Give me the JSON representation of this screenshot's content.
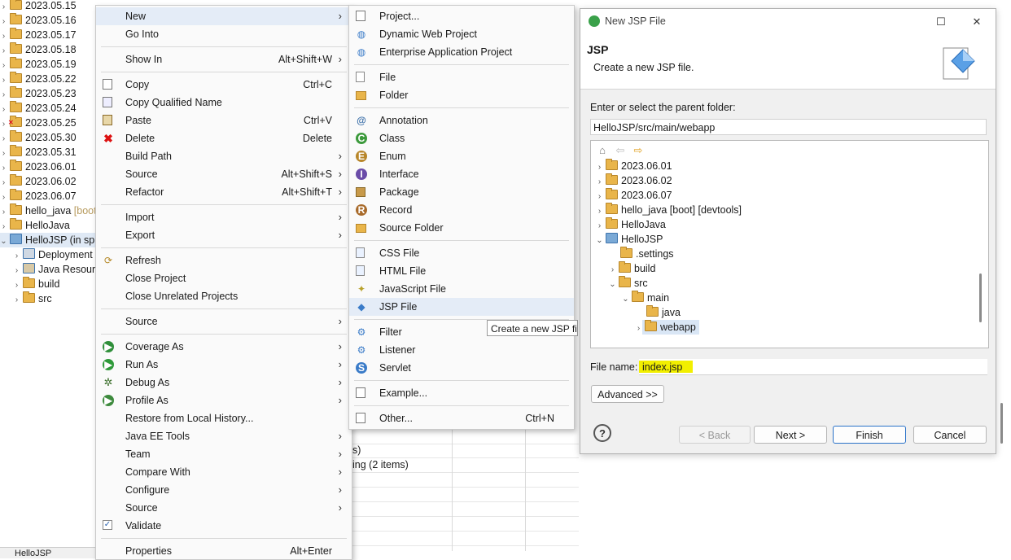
{
  "explorer": {
    "items": [
      {
        "label": "2023.05.15",
        "expanded": false,
        "error": false
      },
      {
        "label": "2023.05.16",
        "expanded": false,
        "error": false
      },
      {
        "label": "2023.05.17",
        "expanded": false,
        "error": false
      },
      {
        "label": "2023.05.18",
        "expanded": false,
        "error": false
      },
      {
        "label": "2023.05.19",
        "expanded": false,
        "error": false
      },
      {
        "label": "2023.05.22",
        "expanded": false,
        "error": false
      },
      {
        "label": "2023.05.23",
        "expanded": false,
        "error": false
      },
      {
        "label": "2023.05.24",
        "expanded": false,
        "error": false
      },
      {
        "label": "2023.05.25",
        "expanded": false,
        "error": true
      },
      {
        "label": "2023.05.30",
        "expanded": false,
        "error": false
      },
      {
        "label": "2023.05.31",
        "expanded": false,
        "error": false
      },
      {
        "label": "2023.06.01",
        "expanded": false,
        "error": false
      },
      {
        "label": "2023.06.02",
        "expanded": false,
        "error": false
      },
      {
        "label": "2023.06.07",
        "expanded": false,
        "error": false
      },
      {
        "label": "hello_java",
        "suffix": "[boot",
        "expanded": false,
        "error": false
      },
      {
        "label": "HelloJava",
        "expanded": false,
        "error": false
      },
      {
        "label": "HelloJSP (in spr",
        "expanded": true,
        "error": false,
        "selected": true
      }
    ],
    "children": [
      {
        "label": "Deployment"
      },
      {
        "label": "Java Resourc"
      },
      {
        "label": "build"
      },
      {
        "label": "src"
      }
    ],
    "bottom_tab": "HelloJSP"
  },
  "background": {
    "line1": "s)",
    "line2": "ing (2 items)"
  },
  "context_menu": {
    "items": [
      {
        "label": "New",
        "shortcut": "",
        "submenu": true
      },
      {
        "label": "Go Into",
        "shortcut": "",
        "submenu": false
      },
      {
        "label": "Show In",
        "shortcut": "Alt+Shift+W",
        "submenu": true
      },
      {
        "label": "Copy",
        "shortcut": "Ctrl+C",
        "submenu": false,
        "icon": "copy-icon"
      },
      {
        "label": "Copy Qualified Name",
        "shortcut": "",
        "submenu": false,
        "icon": "copy-qualified-icon"
      },
      {
        "label": "Paste",
        "shortcut": "Ctrl+V",
        "submenu": false,
        "icon": "paste-icon"
      },
      {
        "label": "Delete",
        "shortcut": "Delete",
        "submenu": false,
        "icon": "delete-icon"
      },
      {
        "label": "Build Path",
        "shortcut": "",
        "submenu": true
      },
      {
        "label": "Source",
        "shortcut": "Alt+Shift+S",
        "submenu": true
      },
      {
        "label": "Refactor",
        "shortcut": "Alt+Shift+T",
        "submenu": true
      },
      {
        "label": "Import",
        "shortcut": "",
        "submenu": true
      },
      {
        "label": "Export",
        "shortcut": "",
        "submenu": true
      },
      {
        "label": "Refresh",
        "shortcut": "",
        "submenu": false,
        "icon": "refresh-icon"
      },
      {
        "label": "Close Project",
        "shortcut": "",
        "submenu": false
      },
      {
        "label": "Close Unrelated Projects",
        "shortcut": "",
        "submenu": false
      },
      {
        "label": "Source",
        "shortcut": "",
        "submenu": true
      },
      {
        "label": "Coverage As",
        "shortcut": "",
        "submenu": true,
        "icon": "coverage-icon"
      },
      {
        "label": "Run As",
        "shortcut": "",
        "submenu": true,
        "icon": "run-icon"
      },
      {
        "label": "Debug As",
        "shortcut": "",
        "submenu": true,
        "icon": "debug-icon"
      },
      {
        "label": "Profile As",
        "shortcut": "",
        "submenu": true,
        "icon": "profile-icon"
      },
      {
        "label": "Restore from Local History...",
        "shortcut": "",
        "submenu": false
      },
      {
        "label": "Java EE Tools",
        "shortcut": "",
        "submenu": true
      },
      {
        "label": "Team",
        "shortcut": "",
        "submenu": true
      },
      {
        "label": "Compare With",
        "shortcut": "",
        "submenu": true
      },
      {
        "label": "Configure",
        "shortcut": "",
        "submenu": true
      },
      {
        "label": "Source",
        "shortcut": "",
        "submenu": true
      },
      {
        "label": "Validate",
        "shortcut": "",
        "submenu": false,
        "icon": "check-icon"
      },
      {
        "label": "Properties",
        "shortcut": "Alt+Enter",
        "submenu": false
      }
    ]
  },
  "new_submenu": {
    "items": [
      {
        "label": "Project...",
        "shortcut": ""
      },
      {
        "label": "Dynamic Web Project",
        "shortcut": ""
      },
      {
        "label": "Enterprise Application Project",
        "shortcut": ""
      },
      {
        "label": "File",
        "shortcut": ""
      },
      {
        "label": "Folder",
        "shortcut": ""
      },
      {
        "label": "Annotation",
        "shortcut": ""
      },
      {
        "label": "Class",
        "shortcut": ""
      },
      {
        "label": "Enum",
        "shortcut": ""
      },
      {
        "label": "Interface",
        "shortcut": ""
      },
      {
        "label": "Package",
        "shortcut": ""
      },
      {
        "label": "Record",
        "shortcut": ""
      },
      {
        "label": "Source Folder",
        "shortcut": ""
      },
      {
        "label": "CSS File",
        "shortcut": ""
      },
      {
        "label": "HTML File",
        "shortcut": ""
      },
      {
        "label": "JavaScript File",
        "shortcut": ""
      },
      {
        "label": "JSP File",
        "shortcut": ""
      },
      {
        "label": "Filter",
        "shortcut": ""
      },
      {
        "label": "Listener",
        "shortcut": ""
      },
      {
        "label": "Servlet",
        "shortcut": ""
      },
      {
        "label": "Example...",
        "shortcut": ""
      },
      {
        "label": "Other...",
        "shortcut": "Ctrl+N"
      }
    ],
    "tooltip": "Create a new JSP fil"
  },
  "dialog": {
    "title": "New JSP File",
    "banner_title": "JSP",
    "banner_desc": "Create a new JSP file.",
    "parent_label": "Enter or select the parent folder:",
    "parent_value": "HelloJSP/src/main/webapp",
    "tree": [
      {
        "label": "2023.06.01"
      },
      {
        "label": "2023.06.02"
      },
      {
        "label": "2023.06.07"
      },
      {
        "label": "hello_java [boot] [devtools]"
      },
      {
        "label": "HelloJava"
      },
      {
        "label": "HelloJSP"
      },
      {
        "label": ".settings"
      },
      {
        "label": "build"
      },
      {
        "label": "src"
      },
      {
        "label": "main"
      },
      {
        "label": "java"
      },
      {
        "label": "webapp"
      }
    ],
    "file_label": "File name:",
    "file_value": "index.jsp",
    "advanced": "Advanced >>",
    "help": "?",
    "back": "< Back",
    "next": "Next >",
    "finish": "Finish",
    "cancel": "Cancel",
    "highlight_color": "#f2ef00"
  }
}
